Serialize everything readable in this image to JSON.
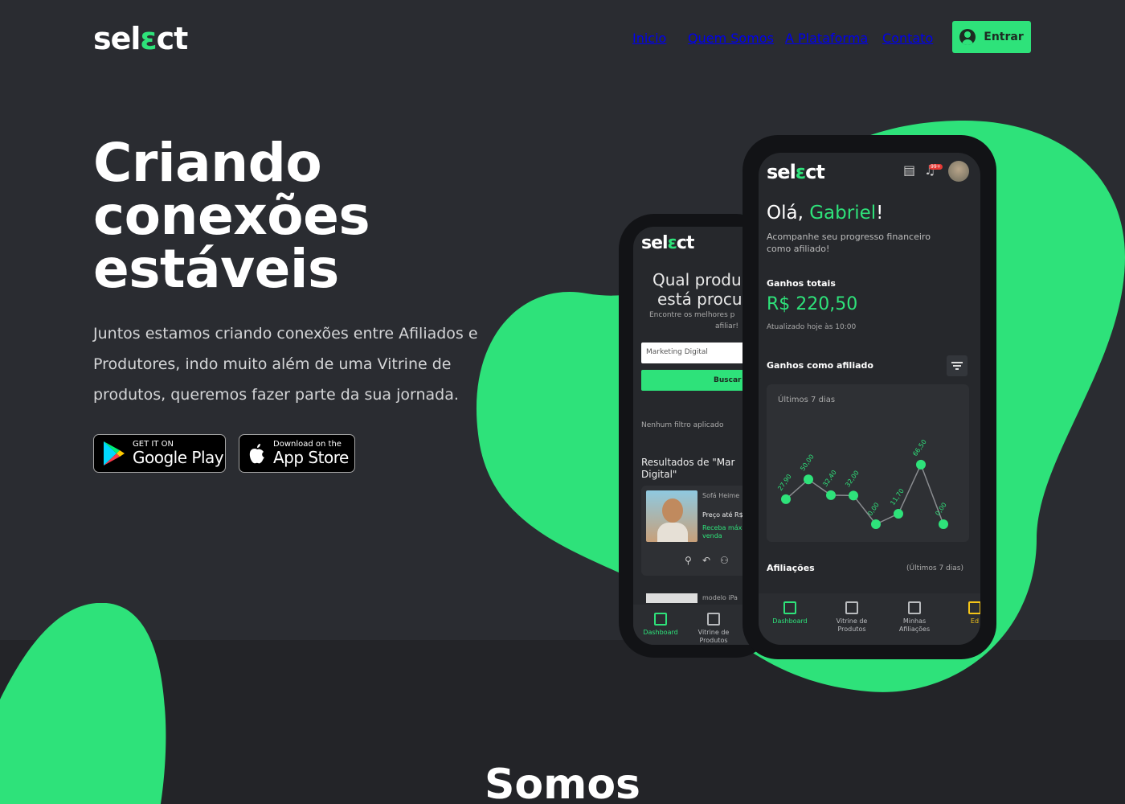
{
  "brand": {
    "logo_pre": "sel",
    "logo_check": "ɛ",
    "logo_post": "ct",
    "accent": "#2ee27a",
    "background": "#2a2c31"
  },
  "nav": {
    "items": [
      {
        "label": "Inicio"
      },
      {
        "label": "Quem Somos"
      },
      {
        "label": "A Plataforma"
      },
      {
        "label": "Contato"
      }
    ],
    "login_label": "Entrar",
    "login_icon": "user-circle-icon"
  },
  "hero": {
    "title_lines": [
      "Criando",
      "conexões",
      "estáveis"
    ],
    "subtitle": "Juntos estamos criando conexões entre Afiliados e Produtores, indo muito além de uma Vitrine de produtos, queremos fazer parte da sua jornada."
  },
  "stores": {
    "google": {
      "small": "GET IT ON",
      "big": "Google Play"
    },
    "apple": {
      "small": "Download on the",
      "big": "App Store"
    }
  },
  "section_heading": "Somos",
  "phone_back": {
    "heading_line1": "Qual produ",
    "heading_line2": "está procu",
    "hint": "Encontre os melhores p",
    "hint2": "afiliar!",
    "search_value": "Marketing Digital",
    "search_button": "Buscar",
    "filter_text": "Nenhum filtro aplicado",
    "results_line1": "Resultados de  \"Mar",
    "results_line2": "Digital\"",
    "product_name": "Sofá Heime",
    "product_price": "Preço até R$",
    "product_hint": "Receba máx",
    "product_hint2": "venda",
    "product2_name": "modelo iPa",
    "tabs": [
      "Dashboard",
      "Vitrine de Produtos"
    ]
  },
  "phone_front": {
    "greeting_pre": "Olá, ",
    "greeting_name": "Gabriel",
    "greeting_post": "!",
    "subtitle_line1": "Acompanhe seu progresso financeiro",
    "subtitle_line2": "como afiliado!",
    "earnings_label": "Ganhos totais",
    "earnings_value": "R$ 220,50",
    "updated": "Atualizado hoje às 10:00",
    "affiliate_earnings_label": "Ganhos como afiliado",
    "period": "Últimos 7 dias",
    "affiliations_label": "Afiliações",
    "affiliations_period": "(Últimos 7 dias)",
    "notification_badge": "99+",
    "tabs": [
      "Dashboard",
      "Vitrine de Produtos",
      "Minhas Afiliações",
      "Ed"
    ]
  },
  "chart_data": {
    "type": "line",
    "title": "Últimos 7 dias",
    "values": [
      27.9,
      50.0,
      32.4,
      32.0,
      0.0,
      11.7,
      66.5,
      0.0
    ],
    "data_labels": [
      "27,90",
      "50,00",
      "32,40",
      "32,00",
      "0,00",
      "11,70",
      "66,50",
      "0,00"
    ],
    "ylim": [
      0,
      70
    ],
    "grid": false,
    "color": "#2ee27a"
  }
}
